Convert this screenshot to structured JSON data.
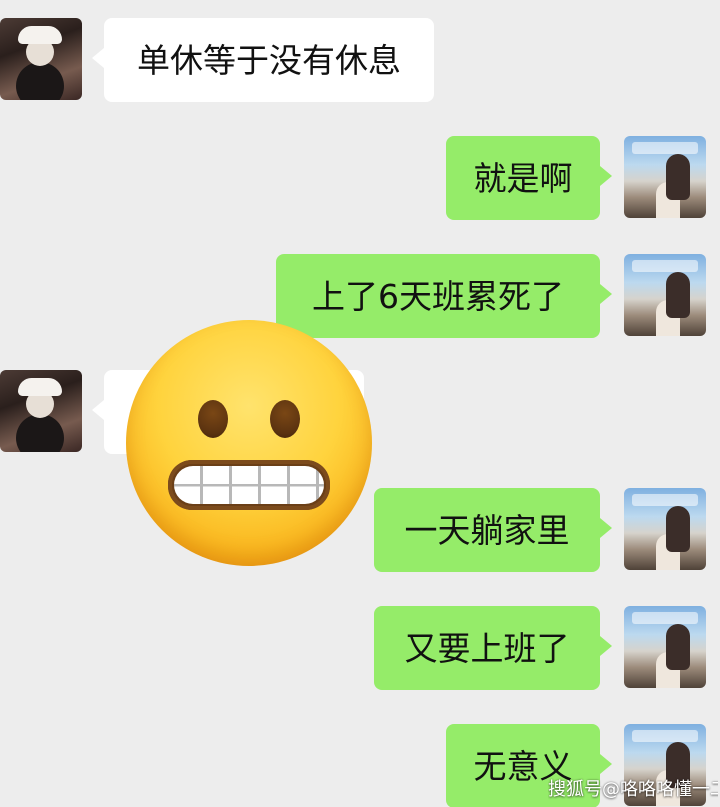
{
  "conversation": {
    "messages": [
      {
        "side": "left",
        "text": "单休等于没有休息"
      },
      {
        "side": "right",
        "text": "就是啊"
      },
      {
        "side": "right",
        "text": "上了6天班累死了"
      },
      {
        "side": "left",
        "text": ""
      },
      {
        "side": "right",
        "text": "一天躺家里"
      },
      {
        "side": "right",
        "text": "又要上班了"
      },
      {
        "side": "right",
        "text": "无意义"
      }
    ]
  },
  "overlay": {
    "emoji_icon": "grimacing-face-emoji"
  },
  "watermark": {
    "text": "搜狐号@咯咯咯懂一二"
  },
  "colors": {
    "chat_background": "#ededed",
    "incoming_bubble": "#ffffff",
    "outgoing_bubble": "#95ec69",
    "emoji_yellow": "#ffd33d"
  }
}
